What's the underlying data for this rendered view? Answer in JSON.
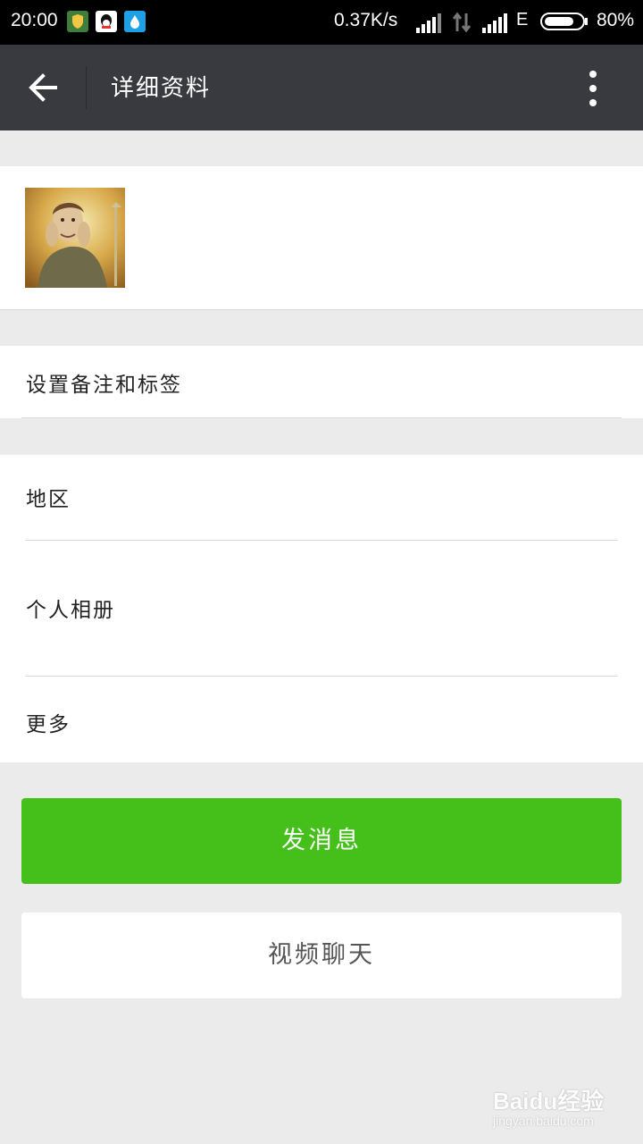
{
  "status_bar": {
    "time": "20:00",
    "net_speed": "0.37K/s",
    "network_type": "E",
    "battery_percent": "80%",
    "battery_level": 0.8,
    "icons": [
      "security-shield-icon",
      "qq-icon",
      "water-drop-icon",
      "signal-icon",
      "data-transfer-icon",
      "signal-icon"
    ]
  },
  "header": {
    "title": "详细资料",
    "back_icon": "arrow-left-icon",
    "more_icon": "more-vertical-icon"
  },
  "profile": {
    "avatar": "avatar-photo"
  },
  "rows": {
    "remark": "设置备注和标签",
    "region": "地区",
    "album": "个人相册",
    "more": "更多"
  },
  "actions": {
    "send_message": "发消息",
    "video_chat": "视频聊天"
  },
  "colors": {
    "header_bg": "#393a3f",
    "primary_green": "#45c01a",
    "page_bg": "#ebebeb"
  },
  "watermark": {
    "brand": "Baidu经验",
    "url": "jingyan.baidu.com"
  }
}
